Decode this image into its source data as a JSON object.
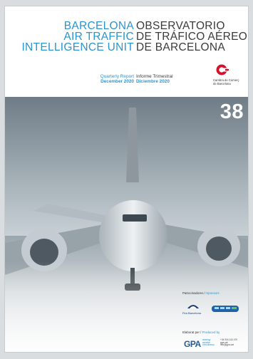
{
  "title_en": [
    "BARCELONA",
    "AIR TRAFFIC",
    "INTELLIGENCE UNIT"
  ],
  "title_es": [
    "OBSERVATORIO",
    "DE TRÁFICO AÉREO",
    "DE BARCELONA"
  ],
  "report_en": {
    "label": "Quarterly Report",
    "date": "December 2020"
  },
  "report_es": {
    "label": "Informe Trimestral",
    "date": "Diciembre 2020"
  },
  "publisher": {
    "line1": "Cambra de Comerç",
    "line2": "de Barcelona"
  },
  "issue_number": "38",
  "sponsors": {
    "label": "Patrocinadores / ",
    "label_en": "Sponsors",
    "sponsor1": "Fira Barcelona"
  },
  "produced": {
    "label": "Elaborat per / ",
    "label_en": "Produced by",
    "gpa_logo": "GPA",
    "tagline": [
      "strategy",
      "aviation",
      "consultancy"
    ],
    "contact": [
      "+34 934 143 470",
      "gpa.cat",
      "info@gpa.cat"
    ]
  },
  "colors": {
    "accent_blue": "#2a95cf",
    "publisher_red": "#d4122b",
    "photo_sky": "#b8c4cc"
  },
  "icons": [
    "cambra-logo-icon",
    "airplane-photo",
    "sponsor-logo-icon"
  ]
}
